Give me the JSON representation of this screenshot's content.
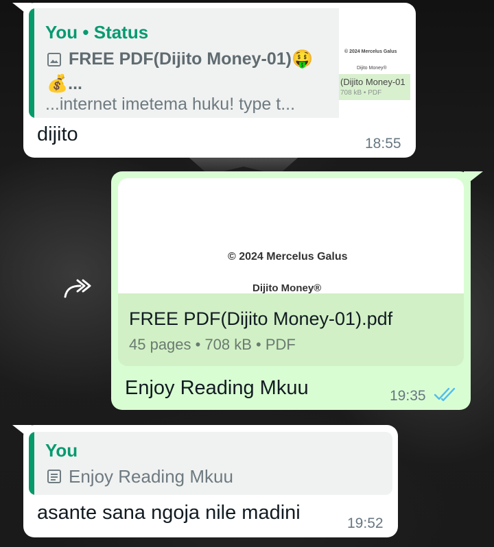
{
  "messages": [
    {
      "quote": {
        "author": "You • Status",
        "title_line1": "FREE PDF(Dijito Money-01)🤑",
        "title_line2": "💰...",
        "subtitle": "...internet imetema huku! type t...",
        "thumb_line1": "© 2024 Mercelus Galus",
        "thumb_line2": "Dijito Money®",
        "thumb_line3": "(Dijito Money-01",
        "thumb_line4": "708 kB • PDF"
      },
      "text": "dijito",
      "time": "18:55"
    },
    {
      "document": {
        "preview_copyright": "© 2024 Mercelus Galus",
        "preview_brand": "Dijito Money®",
        "filename": "FREE PDF(Dijito Money-01).pdf",
        "meta": "45 pages • 708 kB • PDF"
      },
      "text": "Enjoy Reading Mkuu",
      "time": "19:35",
      "status": "read"
    },
    {
      "quote": {
        "author": "You",
        "title": "Enjoy Reading Mkuu"
      },
      "text": "asante sana ngoja nile madini",
      "time": "19:52"
    }
  ],
  "colors": {
    "accent": "#069a6a",
    "outgoing_bubble": "#d9fdd3",
    "incoming_bubble": "#ffffff",
    "read_ticks": "#53bdeb"
  },
  "icons": {
    "status_image": "image-icon",
    "forward": "forward-icon",
    "read_receipt": "double-check-icon",
    "text_quote": "document-text-icon"
  }
}
